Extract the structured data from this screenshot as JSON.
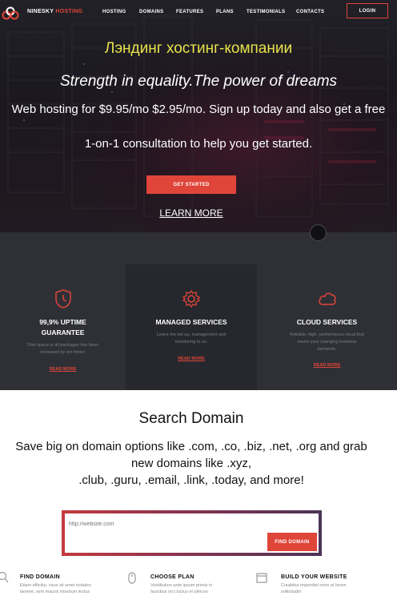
{
  "nav": {
    "brand_prefix": "NINESKY",
    "brand_accent": "HOSTING",
    "items": [
      "HOSTING",
      "DOMAINS",
      "FEATURES",
      "PLANS",
      "TESTIMONIALS",
      "CONTACTS"
    ],
    "login": "LOGIN"
  },
  "hero": {
    "ru_title": "Лэндинг хостинг-компании",
    "tagline": "Strength in equality.The power of dreams",
    "subtitle": "Web hosting for $9.95/mo $2.95/mo. Sign up today and also get a free",
    "subtitle2": "1-on-1 consultation to help you get started.",
    "cta": "GET STARTED",
    "learn_more": "LEARN MORE"
  },
  "features": [
    {
      "icon": "shield-clock-icon",
      "title_line1": "99,9% UPTIME",
      "title_line2": "GUARANTEE",
      "desc_line1": "Disk space in all packages has been",
      "desc_line2": "increased by ten times!",
      "link": "READ MORE"
    },
    {
      "icon": "gear-icon",
      "title_line1": "MANAGED SERVICES",
      "title_line2": "",
      "desc_line1": "Leave the set up, management and",
      "desc_line2": "monitoring to us.",
      "link": "READ MORE"
    },
    {
      "icon": "cloud-icon",
      "title_line1": "CLOUD SERVICES",
      "title_line2": "",
      "desc_line1": "Reliable, high- performance cloud that",
      "desc_line2": "meets your changing business",
      "desc_line3": "demands.",
      "link": "READ MORE"
    }
  ],
  "search": {
    "title": "Search Domain",
    "subtitle_line1": "Save big on domain options like .com, .co, .biz, .net, .org and grab",
    "subtitle_line2": "new domains like .xyz,",
    "subtitle_line3": ".club, .guru, .email, .link, .today, and more!",
    "placeholder": "http://website.com",
    "button": "FIND DOMAIN"
  },
  "steps": [
    {
      "icon": "search-icon",
      "title": "FIND DOMAIN",
      "desc_line1": "Etiam efficitur, risus sit amet sodales",
      "desc_line2": "laoreet, sem mauris interdum lectus"
    },
    {
      "icon": "mouse-icon",
      "title": "CHOOSE PLAN",
      "desc_line1": "Vestibulum ante ipsum primis in",
      "desc_line2": "faucibus orci luctus et ultrices"
    },
    {
      "icon": "browser-window-icon",
      "title": "BUILD YOUR WEBSITE",
      "desc_line1": "Curabitur imperdiet enim at lorem",
      "desc_line2": "sollicitudin"
    }
  ],
  "colors": {
    "accent": "#e0453a",
    "ru_title": "#e8e34a",
    "dark": "#2f3036",
    "card_mid": "#27282d"
  }
}
